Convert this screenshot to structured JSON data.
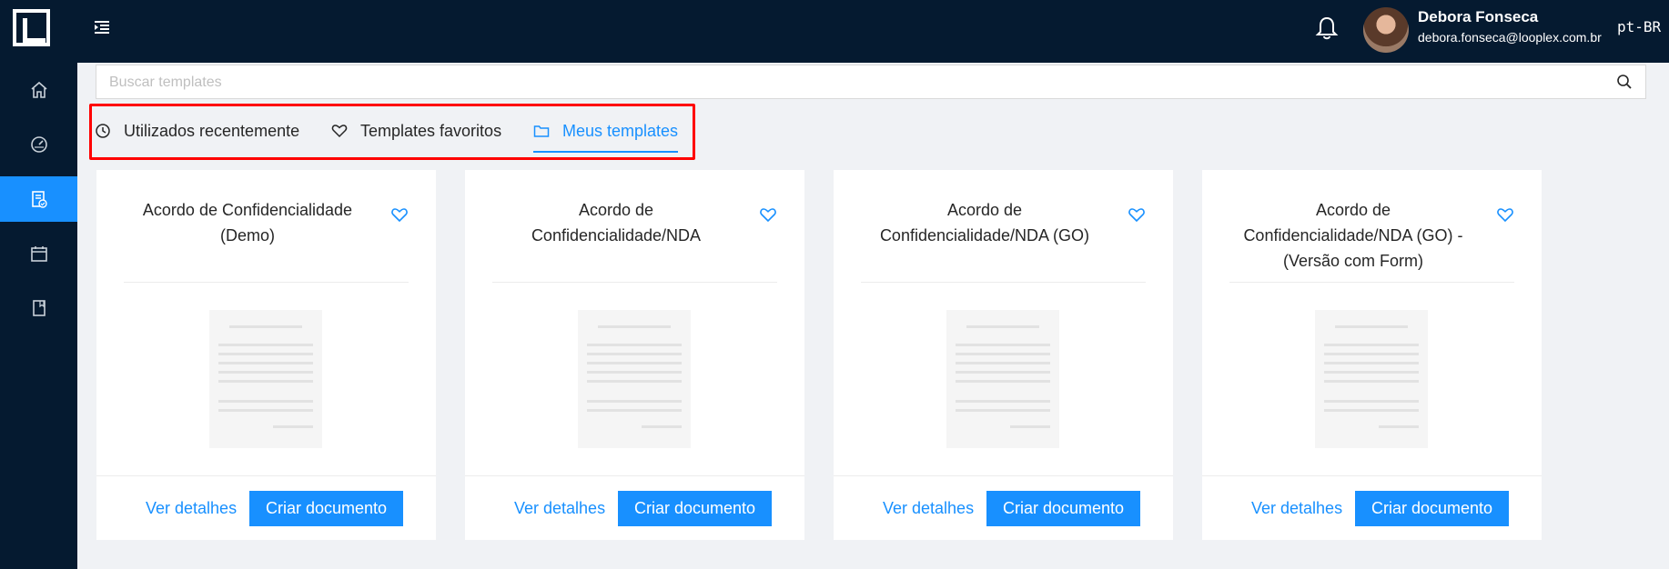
{
  "header": {
    "user_name": "Debora Fonseca",
    "user_email": "debora.fonseca@looplex.com.br",
    "language": "pt-BR"
  },
  "sidebar": {
    "items": [
      {
        "icon": "home-icon"
      },
      {
        "icon": "dashboard-gauge-icon"
      },
      {
        "icon": "templates-document-icon",
        "active": true
      },
      {
        "icon": "calendar-icon"
      },
      {
        "icon": "book-icon"
      }
    ]
  },
  "search": {
    "placeholder": "Buscar templates"
  },
  "tabs": [
    {
      "label": "Utilizados recentemente",
      "icon": "clock-icon"
    },
    {
      "label": "Templates favoritos",
      "icon": "heart-icon"
    },
    {
      "label": "Meus templates",
      "icon": "folder-icon",
      "active": true
    }
  ],
  "cards": [
    {
      "title": "Acordo de Confidencialidade (Demo)",
      "details_label": "Ver detalhes",
      "create_label": "Criar documento"
    },
    {
      "title": "Acordo de Confidencialidade/NDA",
      "details_label": "Ver detalhes",
      "create_label": "Criar documento"
    },
    {
      "title": "Acordo de Confidencialidade/NDA (GO)",
      "details_label": "Ver detalhes",
      "create_label": "Criar documento"
    },
    {
      "title": "Acordo de Confidencialidade/NDA (GO) - (Versão com Form)",
      "details_label": "Ver detalhes",
      "create_label": "Criar documento"
    }
  ],
  "colors": {
    "nav_background": "#051a30",
    "accent": "#1890ff",
    "highlight_frame": "#ff0000"
  }
}
